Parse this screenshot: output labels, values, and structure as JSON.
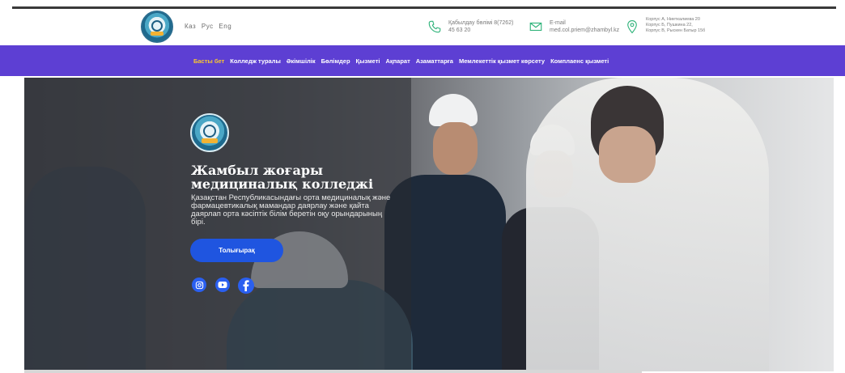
{
  "languages": [
    "Каз",
    "Рус",
    "Eng"
  ],
  "contacts": {
    "phone": {
      "label": "Қабылдау бөлімі 8(7262)",
      "number": "45 63 20"
    },
    "email": {
      "label": "E-mail",
      "value": "med.col.priem@zhambyl.kz"
    },
    "address": {
      "lines": [
        "Корпус А, Ниеткалиева 20",
        "Корпус Б, Пушкина 22,",
        "Корпус В, Рыскен Батыр 15б"
      ]
    }
  },
  "nav": {
    "items": [
      "Басты бет",
      "Колледж туралы",
      "Әкімшілік",
      "Бөлімдер",
      "Қызметі",
      "Ақпарат",
      "Азаматтарға",
      "Мемлекеттік қызмет көрсету",
      "Комплаенс қызметі"
    ],
    "active_index": 0
  },
  "hero": {
    "title": "Жамбыл жоғары медициналық колледжі",
    "description": "Қазақстан Республикасындағы орта медициналық және фармацевтикалық мамандар даярлау және қайта даярлап орта кәсіптік білім беретін оқу орындарының бірі.",
    "button": "Толығырақ"
  },
  "social_icons": [
    "instagram-icon",
    "youtube-icon",
    "facebook-icon"
  ],
  "colors": {
    "nav_bg": "#5d3fd3",
    "nav_active": "#f7c531",
    "button": "#1f55e0",
    "social": "#2a5ff0"
  }
}
